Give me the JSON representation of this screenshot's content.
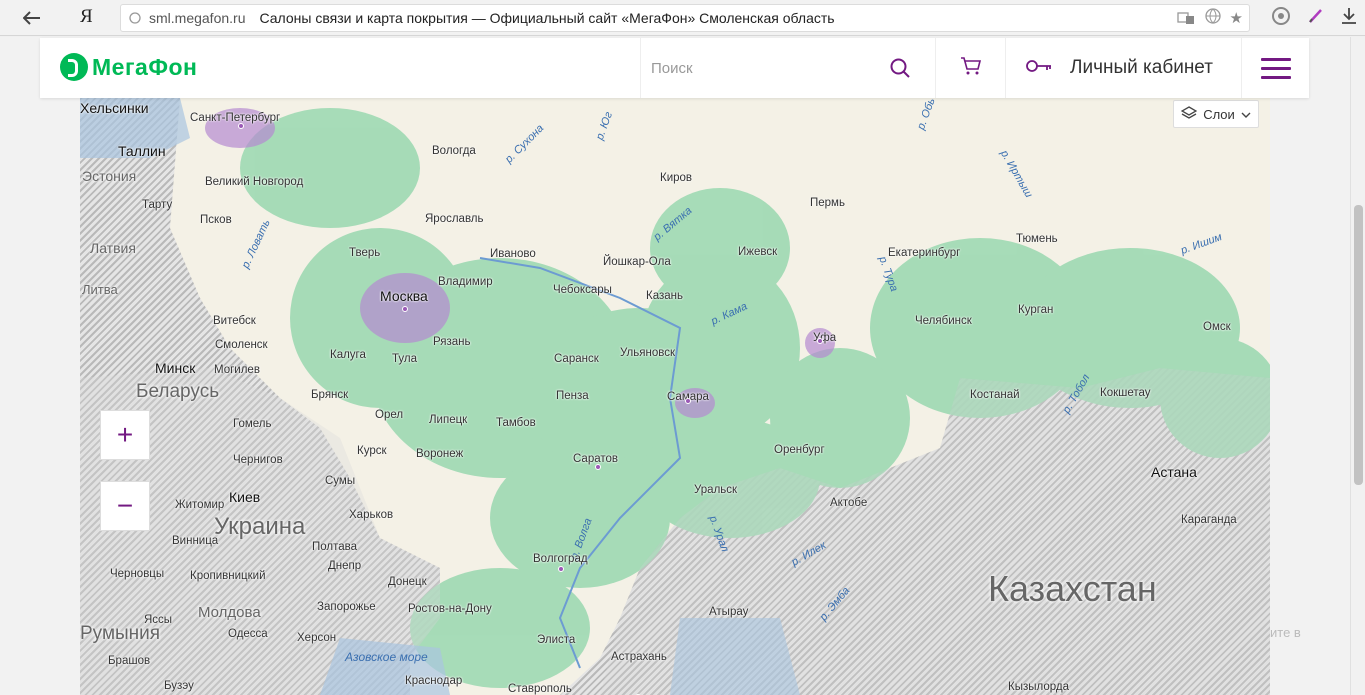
{
  "browser": {
    "back_icon": "back-arrow-icon",
    "ya_label": "Я",
    "domain": "sml.megafon.ru",
    "page_title": "Салоны связи и карта покрытия — Официальный сайт «МегаФон» Смоленская область"
  },
  "header": {
    "logo_text": "МегаФон",
    "search_placeholder": "Поиск",
    "account_label": "Личный кабинет"
  },
  "map": {
    "layers_label": "Слои",
    "zoom_in": "+",
    "zoom_out": "−",
    "countries": [
      "Эстония",
      "Латвия",
      "Беларусь",
      "Украина",
      "Казахстан",
      "Молдова",
      "Литва",
      "Румыния"
    ],
    "rivers": [
      "р. Сухона",
      "р. Юг",
      "р. Вятка",
      "р. Кама",
      "р. Ловать",
      "р. Волга",
      "р. Урал",
      "р. Тобол",
      "р. Ишим",
      "р. Иртыш",
      "р. Тура",
      "р. Обь",
      "р. Илек",
      "р. Эмба"
    ],
    "cities": [
      "Хельсинки",
      "Санкт-Петербург",
      "Таллин",
      "Великий Новгород",
      "Тарту",
      "Псков",
      "Вологда",
      "Киров",
      "Пермь",
      "Ярославль",
      "Тверь",
      "Иваново",
      "Йошкар-Ола",
      "Ижевск",
      "Екатеринбург",
      "Тюмень",
      "Москва",
      "Владимир",
      "Чебоксары",
      "Казань",
      "Витебск",
      "Смоленск",
      "Калуга",
      "Тула",
      "Рязань",
      "Челябинск",
      "Курган",
      "Уфа",
      "Омск",
      "Минск",
      "Могилев",
      "Брянск",
      "Саранск",
      "Ульяновск",
      "Орел",
      "Пенза",
      "Самара",
      "Костанай",
      "Кокшетау",
      "Гомель",
      "Липецк",
      "Тамбов",
      "Курск",
      "Воронеж",
      "Чернигов",
      "Саратов",
      "Оренбург",
      "Астана",
      "Сумы",
      "Киев",
      "Житомир",
      "Уральск",
      "Актобе",
      "Харьков",
      "Винница",
      "Полтава",
      "Караганда",
      "Днепр",
      "Волгоград",
      "Черновцы",
      "Кропивницкий",
      "Донецк",
      "Запорожье",
      "Ростов-на-Дону",
      "Атырау",
      "Одесса",
      "Херсон",
      "Элиста",
      "Ясcы",
      "Астрахань",
      "Брашов",
      "Краснодар",
      "Ставрополь",
      "Бузэу",
      "Кызылорда",
      "Азовское море"
    ],
    "hint": "ите в"
  }
}
